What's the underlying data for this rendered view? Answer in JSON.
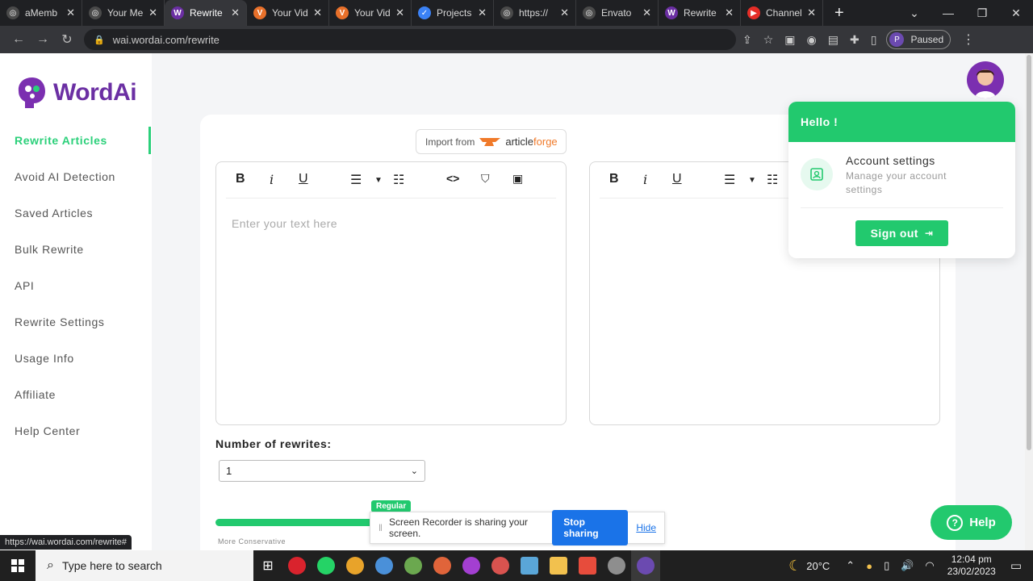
{
  "browser": {
    "tabs": [
      {
        "title": "aMemb",
        "fav_color": "#4a4a4a",
        "glyph": "◎"
      },
      {
        "title": "Your Me",
        "fav_color": "#4a4a4a",
        "glyph": "◎"
      },
      {
        "title": "Rewrite",
        "fav_color": "#6b2fa3",
        "glyph": "W"
      },
      {
        "title": "Your Vid",
        "fav_color": "#e8702a",
        "glyph": "V"
      },
      {
        "title": "Your Vid",
        "fav_color": "#e8702a",
        "glyph": "V"
      },
      {
        "title": "Projects",
        "fav_color": "#3b82f6",
        "glyph": "✓"
      },
      {
        "title": "https://",
        "fav_color": "#4a4a4a",
        "glyph": "◎"
      },
      {
        "title": "Envato",
        "fav_color": "#4a4a4a",
        "glyph": "◎"
      },
      {
        "title": "Rewrite",
        "fav_color": "#6b2fa3",
        "glyph": "W"
      },
      {
        "title": "Channel",
        "fav_color": "#e52d27",
        "glyph": "▶"
      }
    ],
    "url": "wai.wordai.com/rewrite",
    "profile_status": "Paused",
    "profile_initial": "P"
  },
  "app": {
    "brand": "WordAi",
    "brand_color": "#6b2fa3",
    "accent_color": "#22c96e",
    "nav": [
      {
        "label": "Rewrite Articles",
        "active": true
      },
      {
        "label": "Avoid AI Detection",
        "active": false
      },
      {
        "label": "Saved Articles",
        "active": false
      },
      {
        "label": "Bulk Rewrite",
        "active": false
      },
      {
        "label": "API",
        "active": false
      },
      {
        "label": "Rewrite Settings",
        "active": false
      },
      {
        "label": "Usage Info",
        "active": false
      },
      {
        "label": "Affiliate",
        "active": false
      },
      {
        "label": "Help Center",
        "active": false
      }
    ],
    "import_label": "Import from",
    "import_brand_a": "article",
    "import_brand_b": "forge",
    "editor_placeholder": "Enter your text here",
    "rewrites_label": "Number of rewrites:",
    "rewrites_value": "1",
    "slider_badge": "Regular",
    "slider_left_label": "More Conservative",
    "help_label": "Help"
  },
  "dropdown": {
    "greeting": "Hello !",
    "account_title": "Account settings",
    "account_sub": "Manage your account settings",
    "signout": "Sign out"
  },
  "share_bar": {
    "message": "Screen Recorder is sharing your screen.",
    "stop": "Stop sharing",
    "hide": "Hide"
  },
  "status_url": "https://wai.wordai.com/rewrite#",
  "taskbar": {
    "search_placeholder": "Type here to search",
    "weather": "20°C",
    "time": "12:04 pm",
    "date": "23/02/2023"
  }
}
